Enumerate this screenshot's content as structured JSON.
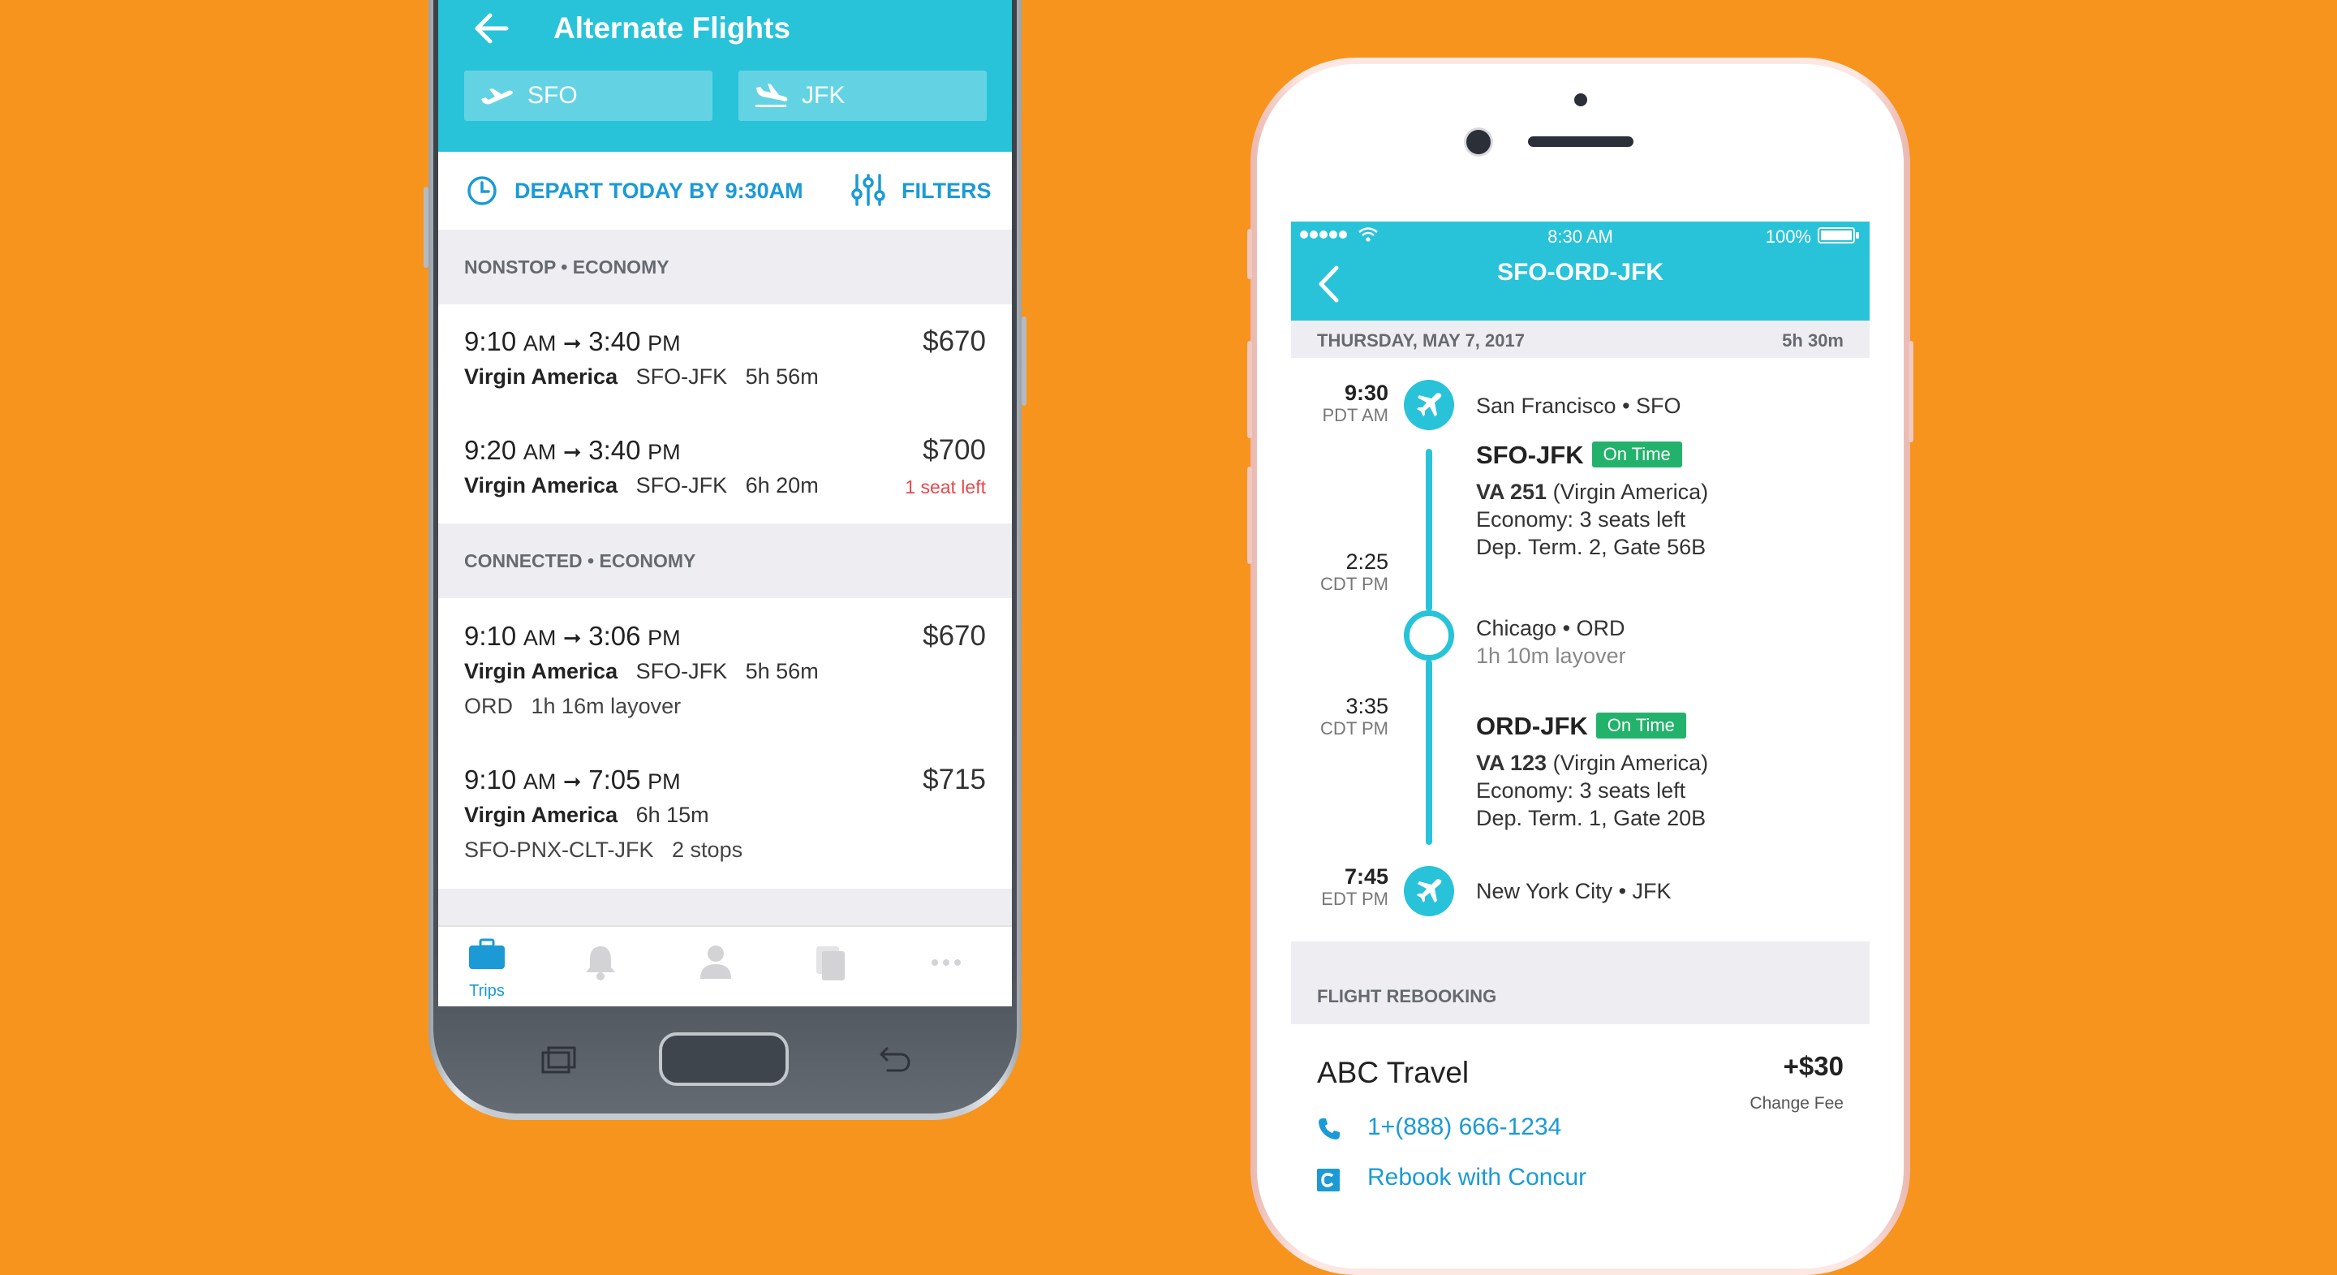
{
  "android": {
    "title": "Alternate Flights",
    "origin": "SFO",
    "destination": "JFK",
    "depart_label": "DEPART TODAY BY 9:30AM",
    "filters_label": "FILTERS",
    "sections": [
      {
        "label": "NONSTOP • ECONOMY",
        "flights": [
          {
            "dep": "9:10",
            "dep_ampm": "AM",
            "arrow": "➞",
            "arr": "3:40",
            "arr_ampm": "PM",
            "carrier": "Virgin America",
            "route": "SFO-JFK",
            "duration": "5h 56m",
            "price": "$670"
          },
          {
            "dep": "9:20",
            "dep_ampm": "AM",
            "arrow": "➞",
            "arr": "3:40",
            "arr_ampm": "PM",
            "carrier": "Virgin America",
            "route": "SFO-JFK",
            "duration": "6h 20m",
            "price": "$700",
            "note": "1 seat left"
          }
        ]
      },
      {
        "label": "CONNECTED • ECONOMY",
        "flights": [
          {
            "dep": "9:10",
            "dep_ampm": "AM",
            "arrow": "➞",
            "arr": "3:06",
            "arr_ampm": "PM",
            "carrier": "Virgin America",
            "route": "SFO-JFK",
            "duration": "5h 56m",
            "price": "$670",
            "line3_a": "ORD",
            "line3_b": "1h 16m layover"
          },
          {
            "dep": "9:10",
            "dep_ampm": "AM",
            "arrow": "➞",
            "arr": "7:05",
            "arr_ampm": "PM",
            "carrier": "Virgin America",
            "duration": "6h 15m",
            "price": "$715",
            "line3_a": "SFO-PNX-CLT-JFK",
            "line3_b": "2 stops"
          }
        ]
      }
    ],
    "tabs": [
      {
        "label": "Trips",
        "icon": "briefcase-icon",
        "active": true
      },
      {
        "label": "",
        "icon": "bell-icon"
      },
      {
        "label": "",
        "icon": "person-icon"
      },
      {
        "label": "",
        "icon": "documents-icon"
      },
      {
        "label": "",
        "icon": "more-icon"
      }
    ]
  },
  "ios": {
    "status": {
      "time": "8:30 AM",
      "battery": "100%"
    },
    "title": "SFO-ORD-JFK",
    "date": "THURSDAY, MAY 7, 2017",
    "total_duration": "5h 30m",
    "stops": [
      {
        "time": "9:30",
        "tz": "PDT",
        "ampm": "AM",
        "place": "San Francisco • SFO"
      },
      {
        "time": "2:25",
        "tz": "CDT",
        "ampm": "PM",
        "place": "Chicago • ORD",
        "sub": "1h 10m layover"
      },
      {
        "time": "3:35",
        "tz": "CDT",
        "ampm": "PM"
      },
      {
        "time": "7:45",
        "tz": "EDT",
        "ampm": "PM",
        "place": "New York City • JFK"
      }
    ],
    "segments": [
      {
        "route": "SFO-JFK",
        "status": "On Time",
        "flight": "VA 251",
        "carrier": "(Virgin America)",
        "cabin": "Economy: 3 seats left",
        "gate": "Dep. Term. 2, Gate 56B"
      },
      {
        "route": "ORD-JFK",
        "status": "On Time",
        "flight": "VA 123",
        "carrier": "(Virgin America)",
        "cabin": "Economy: 3 seats left",
        "gate": "Dep. Term. 1, Gate 20B"
      }
    ],
    "rebooking": {
      "section": "FLIGHT REBOOKING",
      "agency": "ABC Travel",
      "fee": "+$30",
      "fee_label": "Change Fee",
      "phone": "1+(888) 666-1234",
      "rebook_label": "Rebook with Concur"
    }
  },
  "colors": {
    "background": "#F7941D",
    "accent": "#28C3D9",
    "link": "#1B9AD6",
    "ontime": "#23B26B",
    "alert": "#E8484C"
  }
}
